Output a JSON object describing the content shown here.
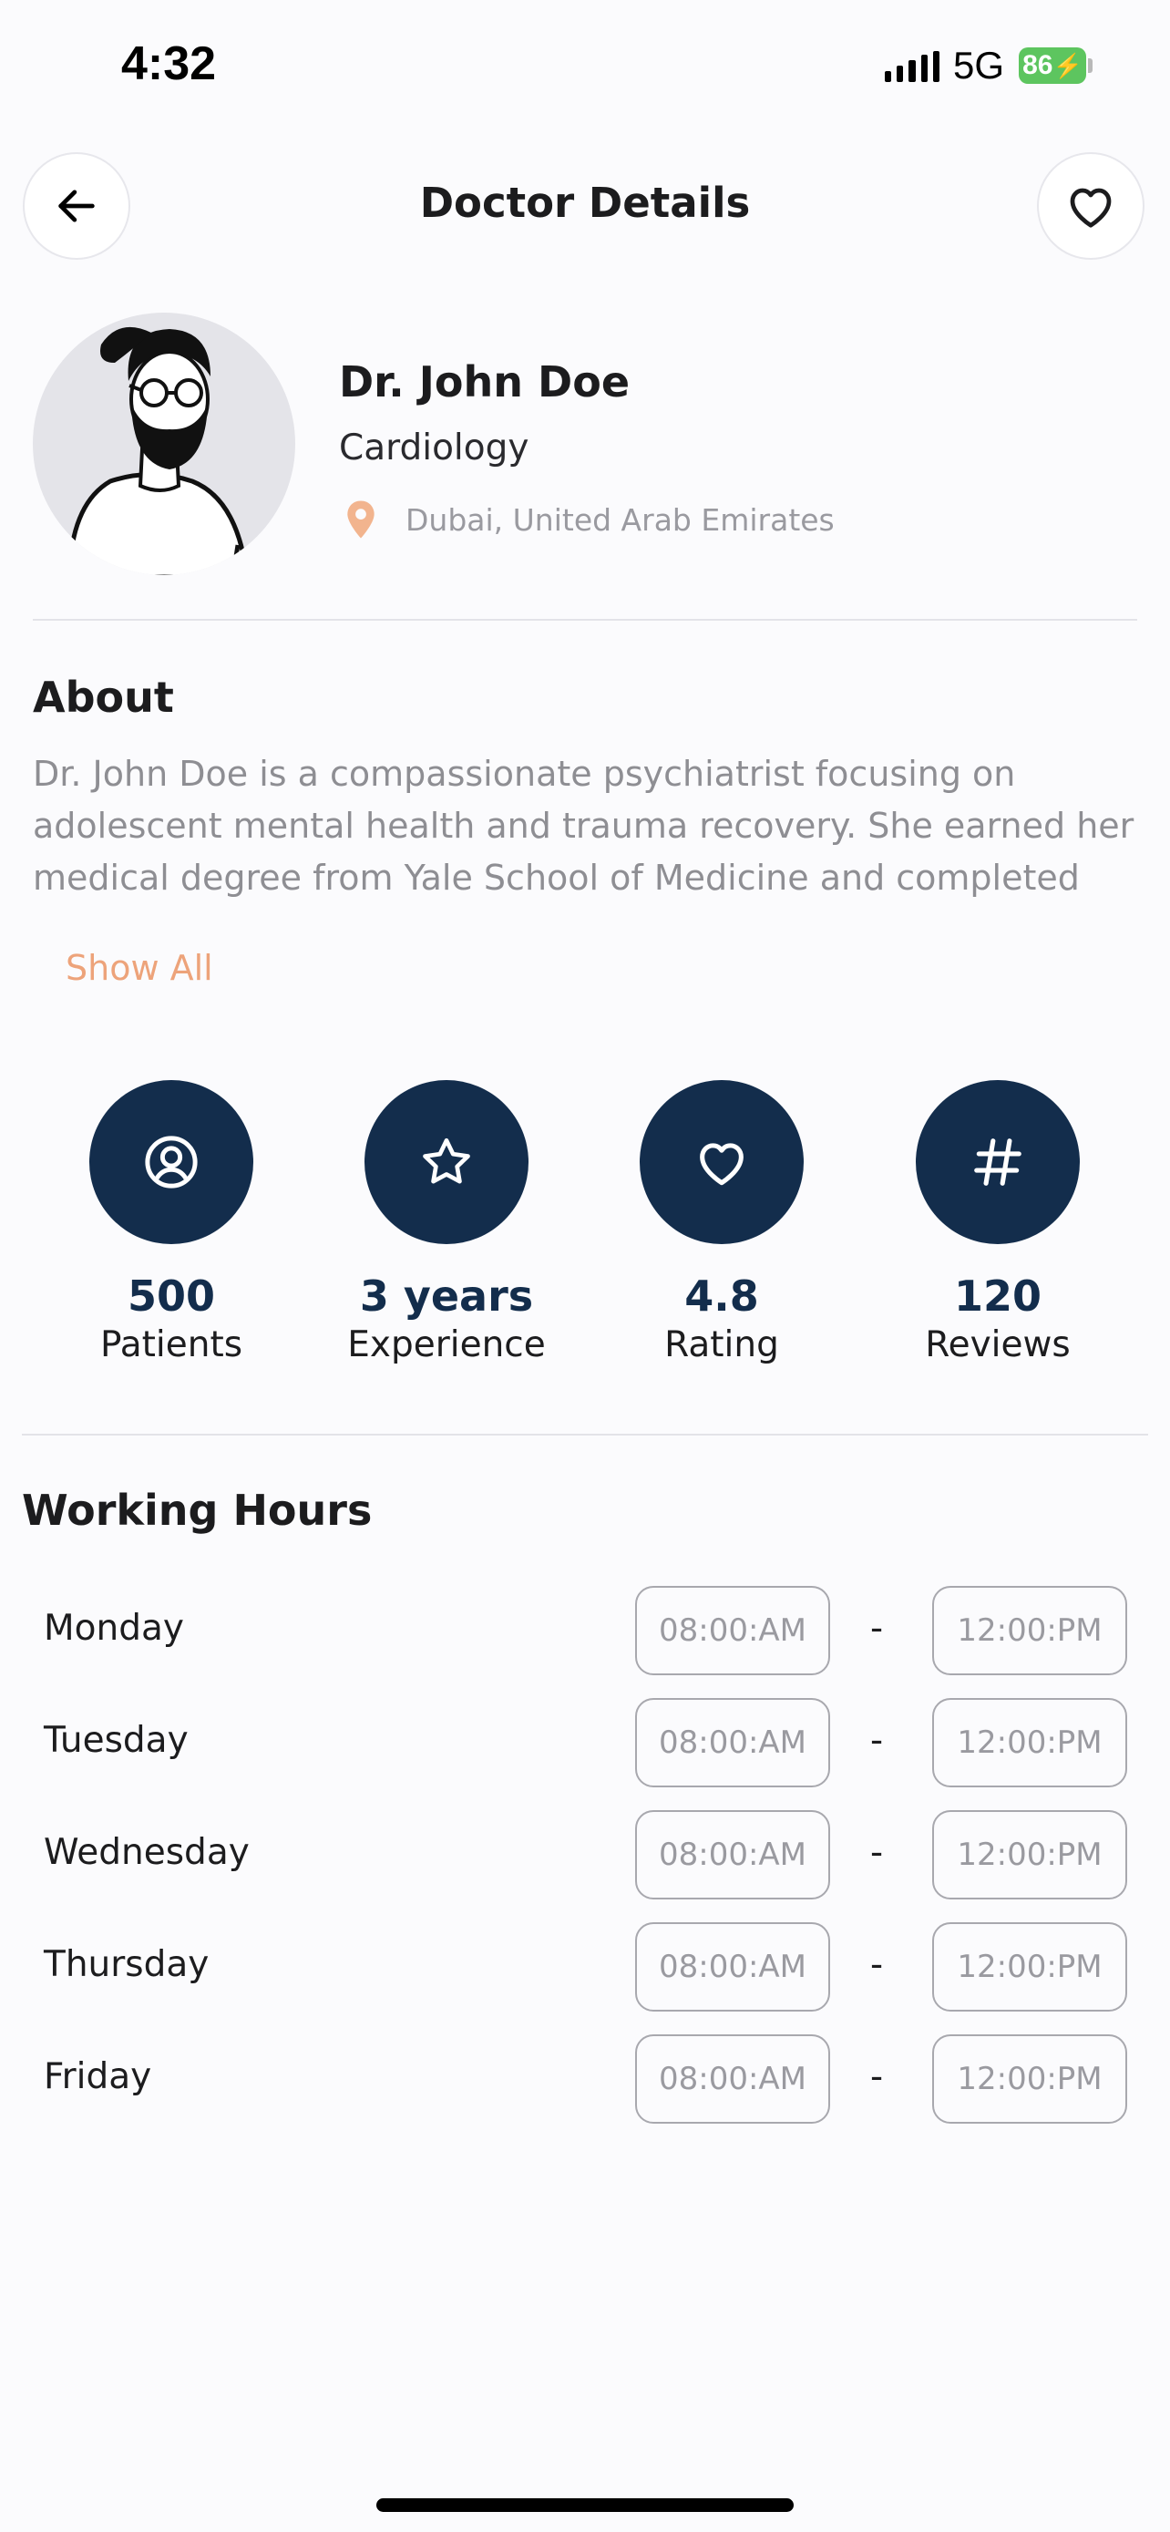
{
  "status_bar": {
    "time": "4:32",
    "network": "5G",
    "battery": "86"
  },
  "header": {
    "title": "Doctor Details",
    "back_icon": "arrow-left-icon",
    "favorite_icon": "heart-icon"
  },
  "doctor": {
    "name": "Dr. John Doe",
    "specialty": "Cardiology",
    "location": "Dubai, United Arab Emirates",
    "location_icon": "map-pin-icon"
  },
  "about": {
    "title": "About",
    "text": "Dr. John Doe is a compassionate psychiatrist focusing on adolescent mental health and trauma recovery. She earned her medical degree from Yale School of Medicine and completed her",
    "show_all_label": "Show All"
  },
  "stats": [
    {
      "value": "500",
      "label": "Patients",
      "icon": "user-circle-icon"
    },
    {
      "value": "3 years",
      "label": "Experience",
      "icon": "star-icon"
    },
    {
      "value": "4.8",
      "label": "Rating",
      "icon": "heart-icon"
    },
    {
      "value": "120",
      "label": "Reviews",
      "icon": "hash-icon"
    }
  ],
  "working_hours": {
    "title": "Working Hours",
    "separator": "-",
    "days": [
      {
        "day": "Monday",
        "start": "08:00:AM",
        "end": "12:00:PM"
      },
      {
        "day": "Tuesday",
        "start": "08:00:AM",
        "end": "12:00:PM"
      },
      {
        "day": "Wednesday",
        "start": "08:00:AM",
        "end": "12:00:PM"
      },
      {
        "day": "Thursday",
        "start": "08:00:AM",
        "end": "12:00:PM"
      },
      {
        "day": "Friday",
        "start": "08:00:AM",
        "end": "12:00:PM"
      }
    ]
  },
  "colors": {
    "accent_navy": "#132D4C",
    "show_all_orange": "#EDA37A",
    "battery_green": "#5DC55F"
  }
}
